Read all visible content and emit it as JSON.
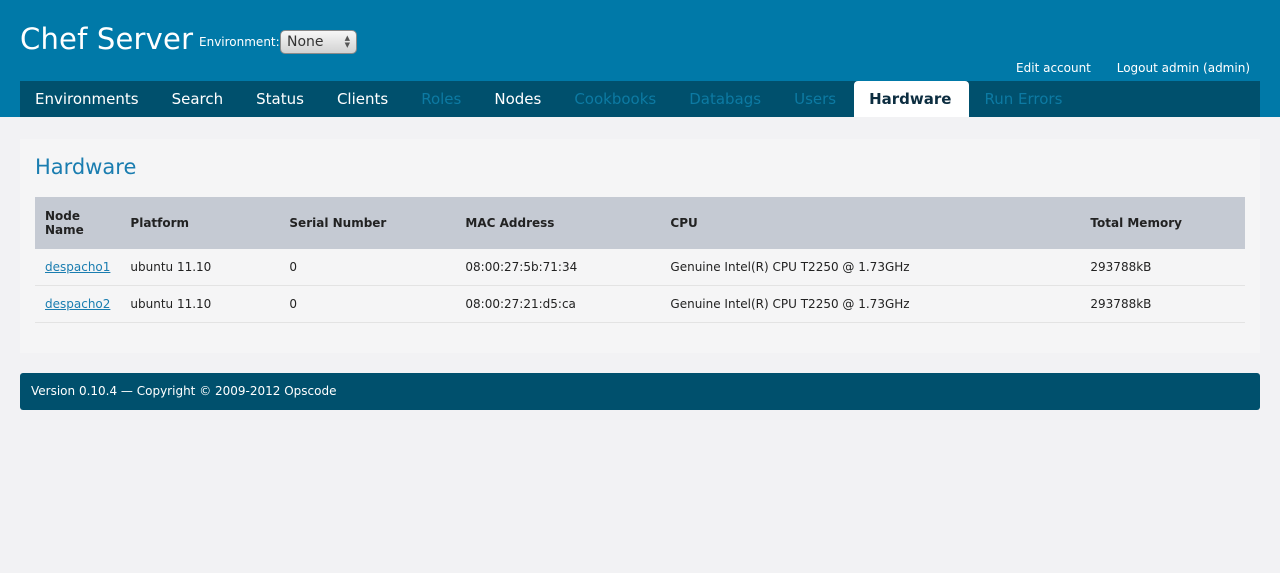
{
  "header": {
    "app_title": "Chef Server",
    "environment_label": "Environment:",
    "environment_value": "None",
    "edit_account": "Edit account",
    "logout": "Logout admin (admin)"
  },
  "nav": [
    {
      "label": "Environments",
      "state": "enabled"
    },
    {
      "label": "Search",
      "state": "enabled"
    },
    {
      "label": "Status",
      "state": "enabled"
    },
    {
      "label": "Clients",
      "state": "enabled"
    },
    {
      "label": "Roles",
      "state": "disabled"
    },
    {
      "label": "Nodes",
      "state": "enabled"
    },
    {
      "label": "Cookbooks",
      "state": "disabled"
    },
    {
      "label": "Databags",
      "state": "disabled"
    },
    {
      "label": "Users",
      "state": "disabled"
    },
    {
      "label": "Hardware",
      "state": "active"
    },
    {
      "label": "Run Errors",
      "state": "disabled"
    }
  ],
  "page": {
    "title": "Hardware"
  },
  "table": {
    "columns": [
      "Node Name",
      "Platform",
      "Serial Number",
      "MAC Address",
      "CPU",
      "Total Memory"
    ],
    "rows": [
      [
        "despacho1",
        "ubuntu 11.10",
        "0",
        "08:00:27:5b:71:34",
        "Genuine Intel(R) CPU T2250 @ 1.73GHz",
        "293788kB"
      ],
      [
        "despacho2",
        "ubuntu 11.10",
        "0",
        "08:00:27:21:d5:ca",
        "Genuine Intel(R) CPU T2250 @ 1.73GHz",
        "293788kB"
      ]
    ]
  },
  "footer": {
    "text": "Version 0.10.4 — Copyright © 2009-2012 Opscode"
  },
  "colors": {
    "header_bg": "#0079a8",
    "nav_bg": "#00506d",
    "link": "#1a7db0",
    "disabled_nav": "#0c7aa3"
  }
}
